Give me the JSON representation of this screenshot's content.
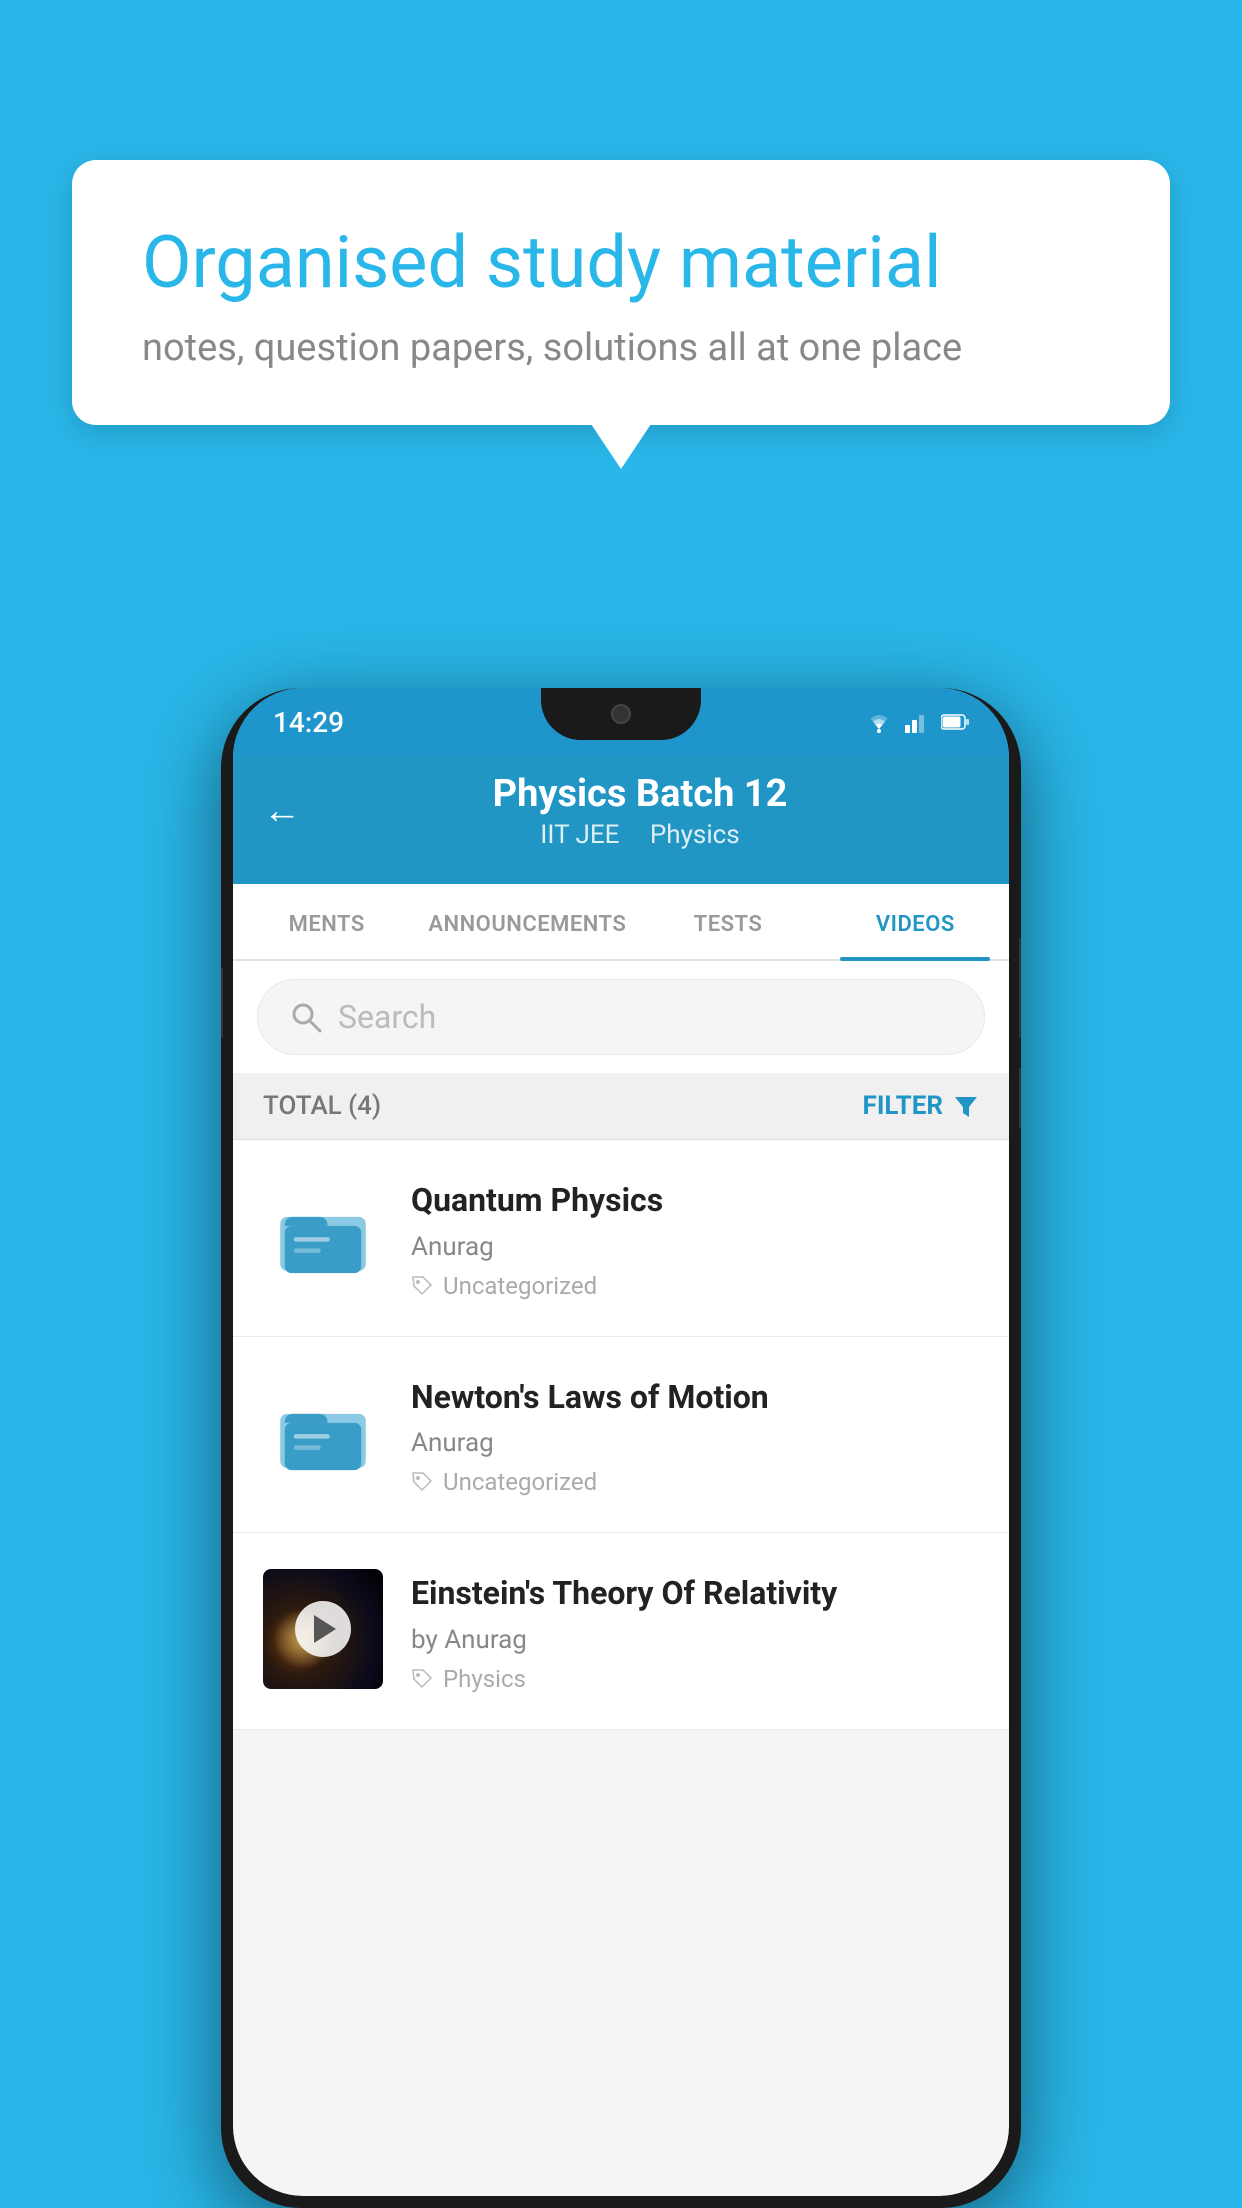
{
  "background_color": "#29b6e8",
  "bubble": {
    "title": "Organised study material",
    "subtitle": "notes, question papers, solutions all at one place"
  },
  "status_bar": {
    "time": "14:29",
    "icons": [
      "wifi",
      "signal",
      "battery"
    ]
  },
  "app_header": {
    "title": "Physics Batch 12",
    "subtitle_tags": [
      "IIT JEE",
      "Physics"
    ]
  },
  "tabs": [
    {
      "label": "MENTS",
      "active": false
    },
    {
      "label": "ANNOUNCEMENTS",
      "active": false
    },
    {
      "label": "TESTS",
      "active": false
    },
    {
      "label": "VIDEOS",
      "active": true
    }
  ],
  "search": {
    "placeholder": "Search"
  },
  "filter_bar": {
    "total_label": "TOTAL (4)",
    "filter_label": "FILTER"
  },
  "videos": [
    {
      "id": 1,
      "title": "Quantum Physics",
      "author": "Anurag",
      "tag": "Uncategorized",
      "has_thumbnail": false
    },
    {
      "id": 2,
      "title": "Newton's Laws of Motion",
      "author": "Anurag",
      "tag": "Uncategorized",
      "has_thumbnail": false
    },
    {
      "id": 3,
      "title": "Einstein's Theory Of Relativity",
      "author": "by Anurag",
      "tag": "Physics",
      "has_thumbnail": true
    }
  ]
}
